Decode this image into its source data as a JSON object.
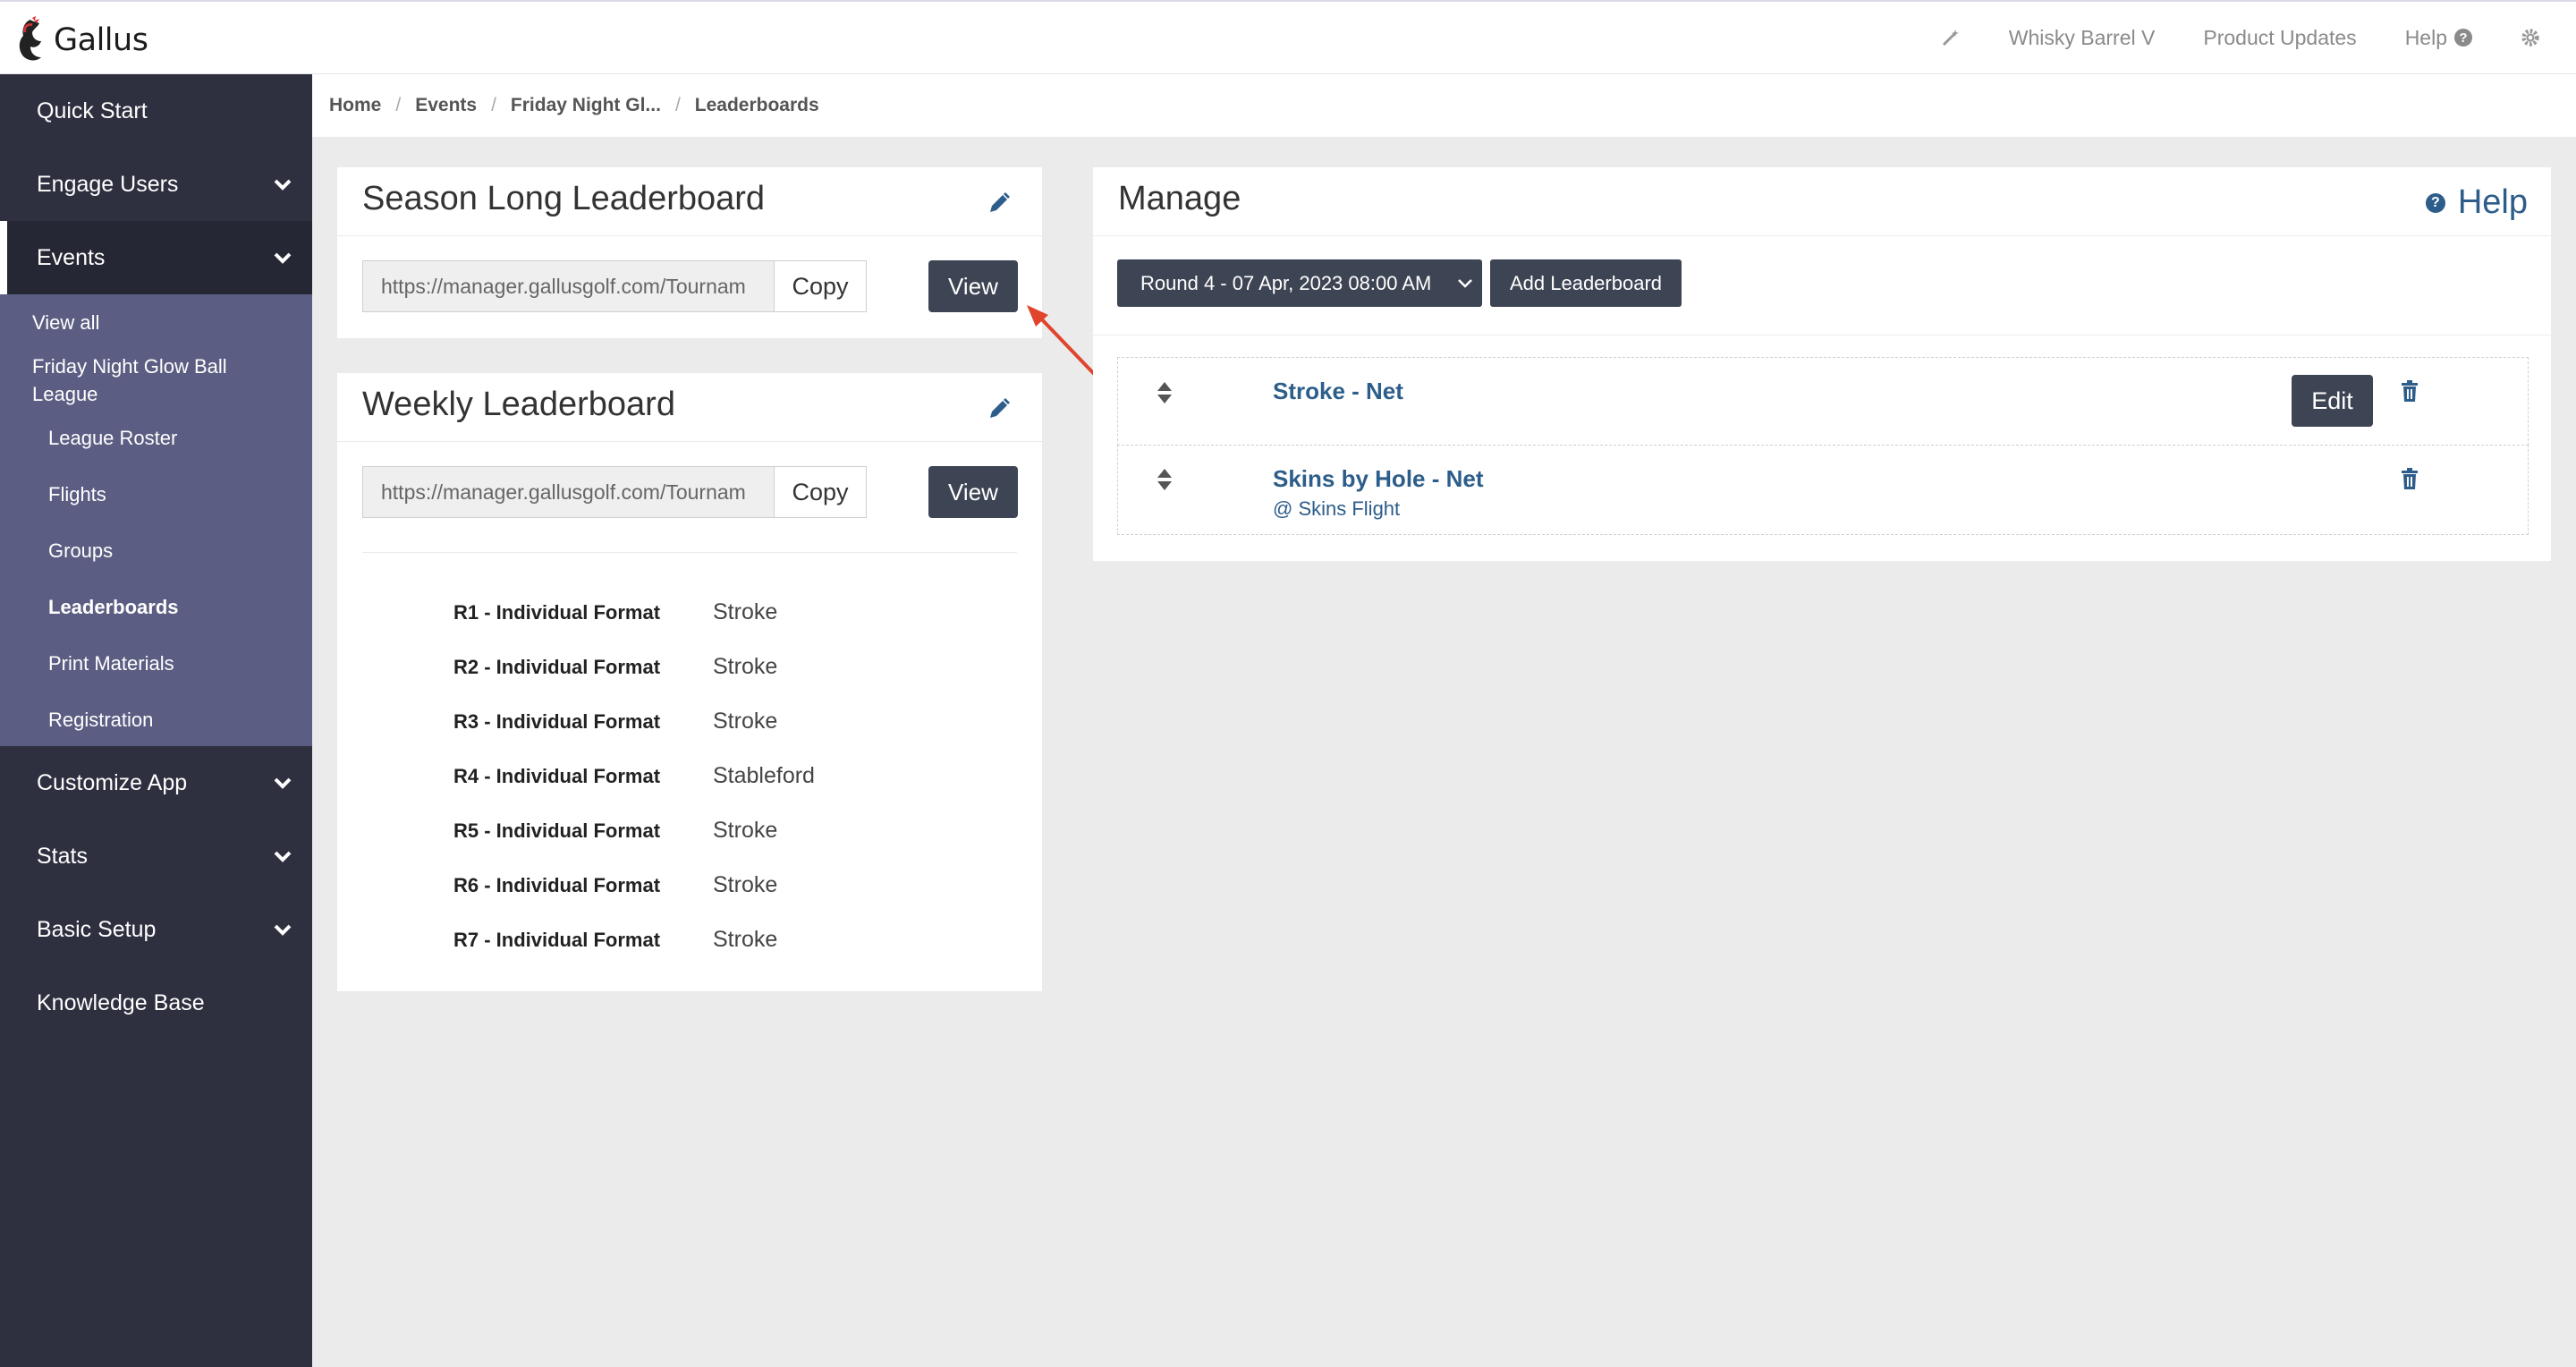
{
  "app": {
    "name": "Gallus"
  },
  "topnav": {
    "org": "Whisky Barrel V",
    "product_updates": "Product Updates",
    "help": "Help"
  },
  "sidebar": {
    "quick_start": "Quick Start",
    "engage_users": "Engage Users",
    "events": "Events",
    "events_sub": {
      "view_all": "View all",
      "event_name": "Friday Night Glow Ball League",
      "league_roster": "League Roster",
      "flights": "Flights",
      "groups": "Groups",
      "leaderboards": "Leaderboards",
      "print_materials": "Print Materials",
      "registration": "Registration"
    },
    "customize_app": "Customize App",
    "stats": "Stats",
    "basic_setup": "Basic Setup",
    "knowledge_base": "Knowledge Base"
  },
  "breadcrumb": [
    "Home",
    "Events",
    "Friday Night Gl...",
    "Leaderboards"
  ],
  "season_panel": {
    "title": "Season Long Leaderboard",
    "url": "https://manager.gallusgolf.com/Tournam",
    "copy_label": "Copy",
    "view_label": "View"
  },
  "weekly_panel": {
    "title": "Weekly Leaderboard",
    "url": "https://manager.gallusgolf.com/Tournam",
    "copy_label": "Copy",
    "view_label": "View",
    "rounds": [
      {
        "label": "R1 - Individual Format",
        "format": "Stroke"
      },
      {
        "label": "R2 - Individual Format",
        "format": "Stroke"
      },
      {
        "label": "R3 - Individual Format",
        "format": "Stroke"
      },
      {
        "label": "R4 - Individual Format",
        "format": "Stableford"
      },
      {
        "label": "R5 - Individual Format",
        "format": "Stroke"
      },
      {
        "label": "R6 - Individual Format",
        "format": "Stroke"
      },
      {
        "label": "R7 - Individual Format",
        "format": "Stroke"
      }
    ]
  },
  "manage_panel": {
    "title": "Manage",
    "help_label": "Help",
    "round_select": "Round 4 - 07 Apr, 2023 08:00 AM",
    "add_label": "Add Leaderboard",
    "leaderboards": [
      {
        "name": "Stroke - Net",
        "edit_label": "Edit"
      },
      {
        "name": "Skins by Hole - Net",
        "subtitle": "@ Skins Flight"
      }
    ]
  },
  "colors": {
    "sidebar_bg": "#2e2f3f",
    "submenu_bg": "#5b5e82",
    "button_dark": "#3d4453",
    "link_blue": "#2d5d8a",
    "annotation_arrow": "#e0442c"
  }
}
